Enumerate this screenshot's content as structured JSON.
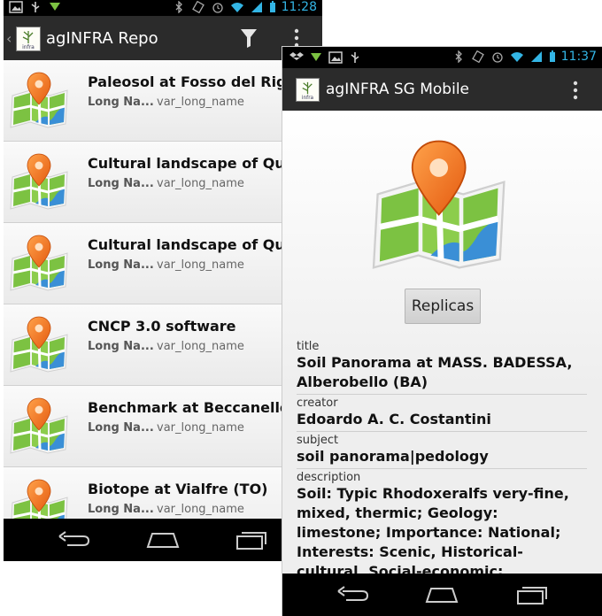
{
  "left_phone": {
    "status_time": "11:28",
    "app_title": "agINFRA Repo",
    "items": [
      {
        "title": "Paleosol at Fosso del Rigo c",
        "sub_label": "Long Na...",
        "sub_value": "var_long_name"
      },
      {
        "title": "Cultural landscape of Querc",
        "sub_label": "Long Na...",
        "sub_value": "var_long_name"
      },
      {
        "title": "Cultural landscape of Querc",
        "sub_label": "Long Na...",
        "sub_value": "var_long_name"
      },
      {
        "title": "CNCP 3.0 software",
        "sub_label": "Long Na...",
        "sub_value": "var_long_name"
      },
      {
        "title": "Benchmark at Beccanello d",
        "sub_label": "Long Na...",
        "sub_value": "var_long_name"
      },
      {
        "title": "Biotope at Vialfre (TO)",
        "sub_label": "Long Na...",
        "sub_value": "var_long_name"
      }
    ]
  },
  "right_phone": {
    "status_time": "11:37",
    "app_title": "agINFRA SG Mobile",
    "replicas_label": "Replicas",
    "fields": {
      "title_label": "title",
      "title_value": "Soil Panorama at MASS. BADESSA, Alberobello (BA)",
      "creator_label": "creator",
      "creator_value": "Edoardo A. C. Costantini",
      "subject_label": "subject",
      "subject_value": "soil panorama|pedology",
      "description_label": "description",
      "description_value": "Soil: Typic Rhodoxeralfs very-fine, mixed, thermic; Geology: limestone; Importance: National; Interests: Scenic, Historical-cultural, Social-economic;"
    }
  },
  "icons": {
    "map": "map-pin-icon",
    "filter": "funnel-icon",
    "overflow": "overflow-menu-icon",
    "back": "back-icon",
    "home": "home-icon",
    "recents": "recent-apps-icon"
  },
  "colors": {
    "accent": "#33b5e5",
    "actionbar": "#2b2b2b",
    "map_green": "#7cc242",
    "map_blue": "#3a8fd6",
    "pin_orange": "#f2781e"
  }
}
